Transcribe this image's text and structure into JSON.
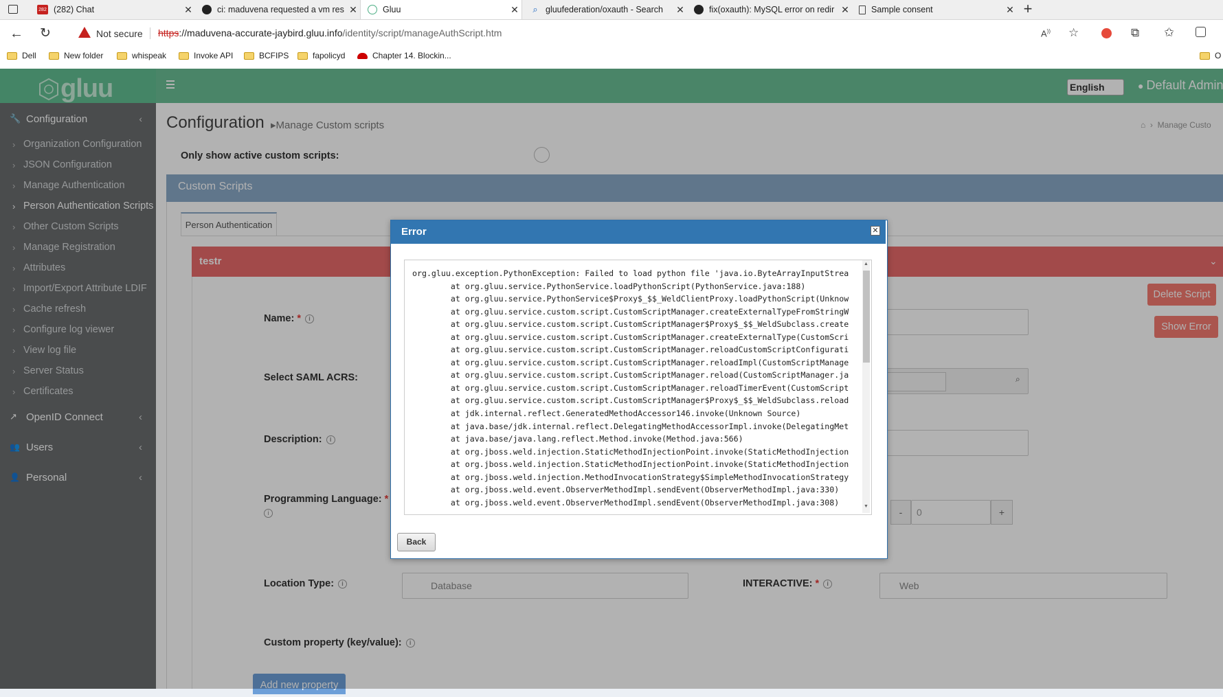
{
  "browser": {
    "tabs": [
      {
        "title": "(282) Chat",
        "favicon_badge": "282"
      },
      {
        "title": "ci: maduvena requested a vm res"
      },
      {
        "title": "Gluu",
        "active": true
      },
      {
        "title": "gluufederation/oxauth - Search"
      },
      {
        "title": "fix(oxauth): MySQL error on redir"
      },
      {
        "title": "Sample consent"
      }
    ],
    "new_tab": "+",
    "security_label": "Not secure",
    "url_scheme": "https",
    "url_host": "://maduvena-accurate-jaybird.gluu.info",
    "url_path": "/identity/script/manageAuthScript.htm",
    "bookmarks": [
      "Dell",
      "New folder",
      "whispeak",
      "Invoke API",
      "BCFIPS",
      "fapolicyd",
      "Chapter 14. Blockin..."
    ],
    "bookmark_overflow": "O"
  },
  "app": {
    "logo_text": "gluu",
    "language": "English",
    "user": "Default Admin",
    "sidebar": {
      "configuration": "Configuration",
      "items": [
        "Organization Configuration",
        "JSON Configuration",
        "Manage Authentication",
        "Person Authentication Scripts",
        "Other Custom Scripts",
        "Manage Registration",
        "Attributes",
        "Import/Export Attribute LDIF",
        "Cache refresh",
        "Configure log viewer",
        "View log file",
        "Server Status",
        "Certificates"
      ],
      "openid": "OpenID Connect",
      "users": "Users",
      "personal": "Personal"
    },
    "page_title": "Configuration",
    "page_subtitle": "Manage Custom scripts",
    "breadcrumb_current": "Manage Custo",
    "active_only_label": "Only show active custom scripts:",
    "panel_title": "Custom Scripts",
    "tab_label": "Person Authentication",
    "script_name": "testr",
    "delete_script": "Delete Script",
    "show_error": "Show Error",
    "labels": {
      "name": "Name:",
      "saml": "Select SAML ACRS:",
      "description": "Description:",
      "language": "Programming Language:",
      "location": "Location Type:",
      "interactive": "INTERACTIVE:",
      "custom_property": "Custom property (key/value):"
    },
    "location_value": "Database",
    "interactive_value": "Web",
    "level_value": "0",
    "stepper_minus": "-",
    "stepper_plus": "+",
    "add_property": "Add new property"
  },
  "dialog": {
    "title": "Error",
    "back": "Back",
    "trace": [
      "org.gluu.exception.PythonException: Failed to load python file 'java.io.ByteArrayInputStrea",
      "        at org.gluu.service.PythonService.loadPythonScript(PythonService.java:188)",
      "        at org.gluu.service.PythonService$Proxy$_$$_WeldClientProxy.loadPythonScript(Unknow",
      "        at org.gluu.service.custom.script.CustomScriptManager.createExternalTypeFromStringW",
      "        at org.gluu.service.custom.script.CustomScriptManager$Proxy$_$$_WeldSubclass.create",
      "        at org.gluu.service.custom.script.CustomScriptManager.createExternalType(CustomScri",
      "        at org.gluu.service.custom.script.CustomScriptManager.reloadCustomScriptConfigurati",
      "        at org.gluu.service.custom.script.CustomScriptManager.reloadImpl(CustomScriptManage",
      "        at org.gluu.service.custom.script.CustomScriptManager.reload(CustomScriptManager.ja",
      "        at org.gluu.service.custom.script.CustomScriptManager.reloadTimerEvent(CustomScript",
      "        at org.gluu.service.custom.script.CustomScriptManager$Proxy$_$$_WeldSubclass.reload",
      "        at jdk.internal.reflect.GeneratedMethodAccessor146.invoke(Unknown Source)",
      "        at java.base/jdk.internal.reflect.DelegatingMethodAccessorImpl.invoke(DelegatingMet",
      "        at java.base/java.lang.reflect.Method.invoke(Method.java:566)",
      "        at org.jboss.weld.injection.StaticMethodInjectionPoint.invoke(StaticMethodInjection",
      "        at org.jboss.weld.injection.StaticMethodInjectionPoint.invoke(StaticMethodInjection",
      "        at org.jboss.weld.injection.MethodInvocationStrategy$SimpleMethodInvocationStrategy",
      "        at org.jboss.weld.event.ObserverMethodImpl.sendEvent(ObserverMethodImpl.java:330)",
      "        at org.jboss.weld.event.ObserverMethodImpl.sendEvent(ObserverMethodImpl.java:308)"
    ]
  },
  "colors": {
    "gluu_green": "#62bf93",
    "sidebar": "#6a6d6f",
    "panel_blue": "#8aa9c8",
    "script_header_red": "#e86a6a",
    "dialog_header": "#3276b1",
    "button_red": "#f47a70"
  }
}
